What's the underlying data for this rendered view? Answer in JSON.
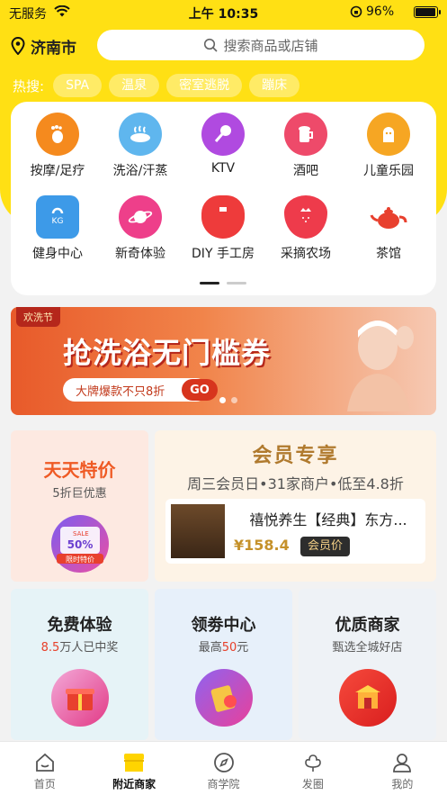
{
  "status": {
    "carrier": "无服务",
    "time": "上午 10:35",
    "battery": "96%"
  },
  "header": {
    "city": "济南市",
    "search_placeholder": "搜索商品或店铺"
  },
  "hot": {
    "label": "热搜:",
    "tags": [
      "SPA",
      "温泉",
      "密室逃脱",
      "蹦床"
    ]
  },
  "categories": [
    {
      "label": "按摩/足疗",
      "icon": "foot-icon",
      "color": "#f58a1e"
    },
    {
      "label": "洗浴/汗蒸",
      "icon": "bath-icon",
      "color": "#5fb6ee"
    },
    {
      "label": "KTV",
      "icon": "microphone-icon",
      "color": "#b04ae0"
    },
    {
      "label": "酒吧",
      "icon": "beer-icon",
      "color": "#ee4a6a"
    },
    {
      "label": "儿童乐园",
      "icon": "child-icon",
      "color": "#f6a623"
    },
    {
      "label": "健身中心",
      "icon": "kettlebell-icon",
      "color": "#3d9ae8"
    },
    {
      "label": "新奇体验",
      "icon": "planet-icon",
      "color": "#ee3f8a"
    },
    {
      "label": "DIY 手工房",
      "icon": "vase-icon",
      "color": "#ee3b3b"
    },
    {
      "label": "采摘农场",
      "icon": "strawberry-icon",
      "color": "#ee3b4b"
    },
    {
      "label": "茶馆",
      "icon": "teapot-icon",
      "color": "#e8402e"
    }
  ],
  "banner": {
    "tag": "欢洗节",
    "headline": "抢洗浴无门槛券",
    "sub": "大牌爆款不只8折",
    "go": "GO"
  },
  "daily": {
    "title": "天天特价",
    "subtitle": "5折巨优惠",
    "badge_top": "SALE",
    "badge_mid": "50%",
    "badge_bottom": "限时特价"
  },
  "vip": {
    "title": "会员专享",
    "subtitle": "周三会员日•31家商户•低至4.8折",
    "shop_name": "禧悦养生【经典】东方...",
    "price": "¥158.4",
    "price_tag": "会员价"
  },
  "free": {
    "title": "免费体验",
    "count": "8.5",
    "suffix": "万人已中奖"
  },
  "coupon": {
    "title": "领劵中心",
    "prefix": "最高",
    "amount": "50",
    "suffix": "元"
  },
  "merchant": {
    "title": "优质商家",
    "subtitle": "甄选全城好店"
  },
  "tabs": [
    {
      "label": "首页",
      "icon": "home-icon"
    },
    {
      "label": "附近商家",
      "icon": "store-icon"
    },
    {
      "label": "商学院",
      "icon": "compass-icon"
    },
    {
      "label": "发圈",
      "icon": "flower-icon"
    },
    {
      "label": "我的",
      "icon": "user-icon"
    }
  ],
  "active_tab": "附近商家"
}
